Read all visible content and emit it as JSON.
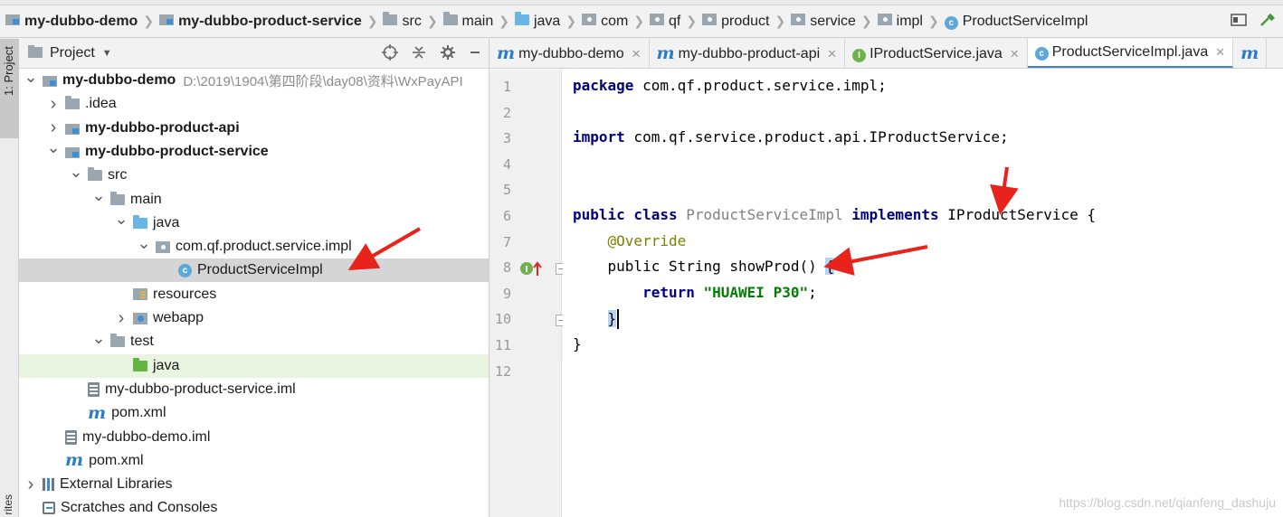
{
  "breadcrumb": [
    {
      "label": "my-dubbo-demo",
      "icon": "module-folder-icon",
      "bold": true
    },
    {
      "label": "my-dubbo-product-service",
      "icon": "module-folder-icon",
      "bold": true
    },
    {
      "label": "src",
      "icon": "folder-icon"
    },
    {
      "label": "main",
      "icon": "folder-icon"
    },
    {
      "label": "java",
      "icon": "source-folder-icon"
    },
    {
      "label": "com",
      "icon": "package-icon"
    },
    {
      "label": "qf",
      "icon": "package-icon"
    },
    {
      "label": "product",
      "icon": "package-icon"
    },
    {
      "label": "service",
      "icon": "package-icon"
    },
    {
      "label": "impl",
      "icon": "package-icon"
    },
    {
      "label": "ProductServiceImpl",
      "icon": "class-icon"
    }
  ],
  "left_stripe": {
    "project_label": "1: Project",
    "favorites_label": "rites"
  },
  "project_panel": {
    "title": "Project",
    "tree": [
      {
        "label": "my-dubbo-demo",
        "path": "D:\\2019\\1904\\第四阶段\\day08\\资料\\WxPayAPI",
        "bold": true,
        "depth": 0,
        "arrow": "open",
        "icon": "module"
      },
      {
        "label": ".idea",
        "depth": 1,
        "arrow": "closed",
        "icon": "folder"
      },
      {
        "label": "my-dubbo-product-api",
        "bold": true,
        "depth": 1,
        "arrow": "closed",
        "icon": "module"
      },
      {
        "label": "my-dubbo-product-service",
        "bold": true,
        "depth": 1,
        "arrow": "open",
        "icon": "module"
      },
      {
        "label": "src",
        "depth": 2,
        "arrow": "open",
        "icon": "folder"
      },
      {
        "label": "main",
        "depth": 3,
        "arrow": "open",
        "icon": "folder"
      },
      {
        "label": "java",
        "depth": 4,
        "arrow": "open",
        "icon": "folder-blue"
      },
      {
        "label": "com.qf.product.service.impl",
        "depth": 5,
        "arrow": "open",
        "icon": "package"
      },
      {
        "label": "ProductServiceImpl",
        "depth": 6,
        "arrow": "none",
        "icon": "class",
        "selected": true
      },
      {
        "label": "resources",
        "depth": 4,
        "arrow": "none",
        "icon": "resources"
      },
      {
        "label": "webapp",
        "depth": 4,
        "arrow": "closed",
        "icon": "web"
      },
      {
        "label": "test",
        "depth": 3,
        "arrow": "open",
        "icon": "folder"
      },
      {
        "label": "java",
        "depth": 4,
        "arrow": "none",
        "icon": "folder-green",
        "highlight": true
      },
      {
        "label": "my-dubbo-product-service.iml",
        "depth": 2,
        "arrow": "none",
        "icon": "iml"
      },
      {
        "label": "pom.xml",
        "depth": 2,
        "arrow": "none",
        "icon": "maven"
      },
      {
        "label": "my-dubbo-demo.iml",
        "depth": 1,
        "arrow": "none",
        "icon": "iml"
      },
      {
        "label": "pom.xml",
        "depth": 1,
        "arrow": "none",
        "icon": "maven"
      },
      {
        "label": "External Libraries",
        "depth": 0,
        "arrow": "closed",
        "icon": "library"
      },
      {
        "label": "Scratches and Consoles",
        "depth": 0,
        "arrow": "none",
        "icon": "scratch"
      }
    ]
  },
  "editor": {
    "tabs": [
      {
        "label": "my-dubbo-demo",
        "icon": "maven"
      },
      {
        "label": "my-dubbo-product-api",
        "icon": "maven"
      },
      {
        "label": "IProductService.java",
        "icon": "interface"
      },
      {
        "label": "ProductServiceImpl.java",
        "icon": "class",
        "active": true
      }
    ],
    "code_lines": [
      {
        "n": "1",
        "tokens": [
          {
            "t": "package",
            "c": "kw"
          },
          {
            "t": " com.qf.product.service.impl;"
          }
        ]
      },
      {
        "n": "2",
        "tokens": []
      },
      {
        "n": "3",
        "tokens": [
          {
            "t": "import",
            "c": "kw"
          },
          {
            "t": " com.qf.service.product.api.IProductService;"
          }
        ]
      },
      {
        "n": "4",
        "tokens": []
      },
      {
        "n": "5",
        "tokens": []
      },
      {
        "n": "6",
        "tokens": [
          {
            "t": "public class",
            "c": "kw"
          },
          {
            "t": " "
          },
          {
            "t": "ProductServiceImpl",
            "c": "cls-gray"
          },
          {
            "t": " "
          },
          {
            "t": "implements",
            "c": "kw"
          },
          {
            "t": " IProductService {"
          }
        ]
      },
      {
        "n": "7",
        "tokens": [
          {
            "t": "    "
          },
          {
            "t": "@Override",
            "c": "anno"
          }
        ]
      },
      {
        "n": "8",
        "tokens": [
          {
            "t": "    public String showProd() {"
          }
        ]
      },
      {
        "n": "9",
        "tokens": [
          {
            "t": "        "
          },
          {
            "t": "return",
            "c": "kw"
          },
          {
            "t": " "
          },
          {
            "t": "\"HUAWEI P30\"",
            "c": "str"
          },
          {
            "t": ";"
          }
        ]
      },
      {
        "n": "10",
        "tokens": [
          {
            "t": "    }"
          }
        ],
        "current": true
      },
      {
        "n": "11",
        "tokens": [
          {
            "t": "}"
          }
        ]
      },
      {
        "n": "12",
        "tokens": []
      }
    ]
  },
  "watermark": "https://blog.csdn.net/qianfeng_dashuju",
  "colors": {
    "accent": "#4083c9",
    "keyword": "#000080",
    "string": "#008000",
    "annotation": "#808000",
    "arrow": "#e8231b"
  }
}
